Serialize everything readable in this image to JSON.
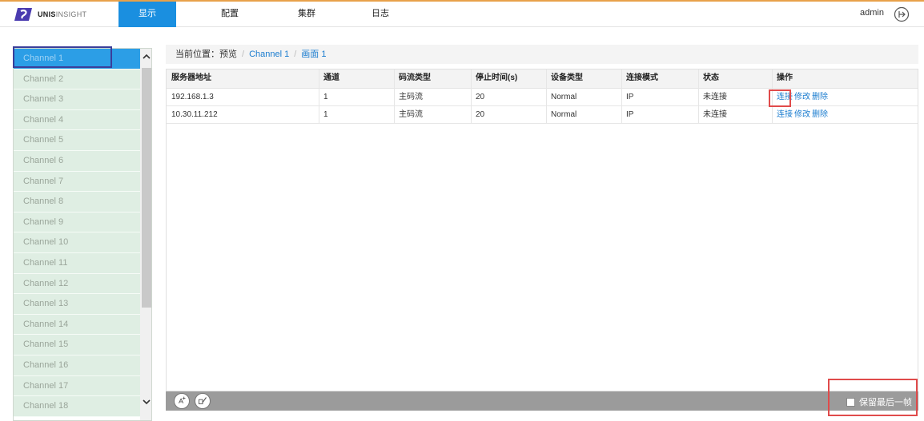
{
  "brand": {
    "strong": "UNIS",
    "light": "INSIGHT",
    "logo_color": "#4a3bb0"
  },
  "nav": {
    "items": [
      {
        "label": "显示",
        "active": true
      },
      {
        "label": "配置",
        "active": false
      },
      {
        "label": "集群",
        "active": false
      },
      {
        "label": "日志",
        "active": false
      }
    ]
  },
  "user": {
    "name": "admin",
    "logout_icon": "logout-icon"
  },
  "sidebar": {
    "channels": [
      "Channel 1",
      "Channel 2",
      "Channel 3",
      "Channel 4",
      "Channel 5",
      "Channel 6",
      "Channel 7",
      "Channel 8",
      "Channel 9",
      "Channel 10",
      "Channel 11",
      "Channel 12",
      "Channel 13",
      "Channel 14",
      "Channel 15",
      "Channel 16",
      "Channel 17",
      "Channel 18"
    ],
    "selected_index": 0
  },
  "breadcrumb": {
    "prefix": "当前位置：",
    "items": [
      "预览",
      "Channel 1",
      "画面 1"
    ]
  },
  "table": {
    "headers": [
      "服务器地址",
      "通道",
      "码流类型",
      "停止时间(s)",
      "设备类型",
      "连接模式",
      "状态",
      "操作"
    ],
    "rows": [
      {
        "cells": [
          "192.168.1.3",
          "1",
          "主码流",
          "20",
          "Normal",
          "IP",
          "未连接"
        ],
        "ops": [
          "连接",
          "修改",
          "删除"
        ]
      },
      {
        "cells": [
          "10.30.11.212",
          "1",
          "主码流",
          "20",
          "Normal",
          "IP",
          "未连接"
        ],
        "ops": [
          "连接",
          "修改",
          "删除"
        ]
      }
    ]
  },
  "toolbar": {
    "keep_last_frame": "保留最后一帧",
    "keep_last_frame_checked": false,
    "buttons": [
      "add-stream-icon",
      "edit-stream-icon"
    ]
  },
  "colors": {
    "accent": "#1a8fe0",
    "top_border": "#e8a14a",
    "highlight": "#e04b4b"
  }
}
